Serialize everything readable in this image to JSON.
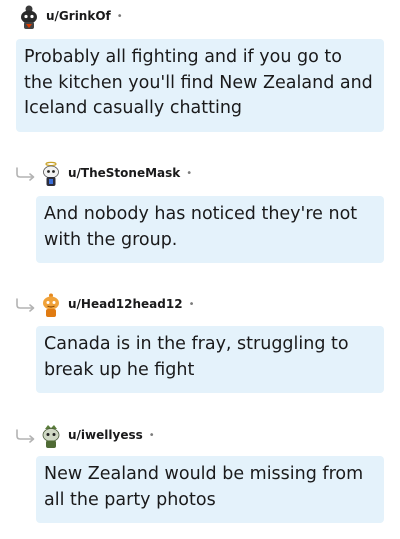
{
  "comments": [
    {
      "username": "u/GrinkOf",
      "separator": "•",
      "text": "Probably all fighting and if you go to the kitchen you'll find New Zealand and Iceland casually chatting",
      "avatar_icon": "dark-snoo-avatar-icon"
    },
    {
      "username": "u/TheStoneMask",
      "separator": "•",
      "text": "And nobody has noticed they're not with the group.",
      "avatar_icon": "halo-snoo-avatar-icon"
    },
    {
      "username": "u/Head12head12",
      "separator": "•",
      "text": "Canada is in the fray, struggling to break up he fight",
      "avatar_icon": "orange-snoo-avatar-icon"
    },
    {
      "username": "u/iwellyess",
      "separator": "•",
      "text": "New Zealand would be missing from all the party photos",
      "avatar_icon": "green-snoo-avatar-icon"
    }
  ],
  "colors": {
    "bubble_bg": "#e4f2fb",
    "text": "#1a1a1b",
    "meta": "#7c7c7c",
    "reply_arrow": "#b3b3b3"
  }
}
